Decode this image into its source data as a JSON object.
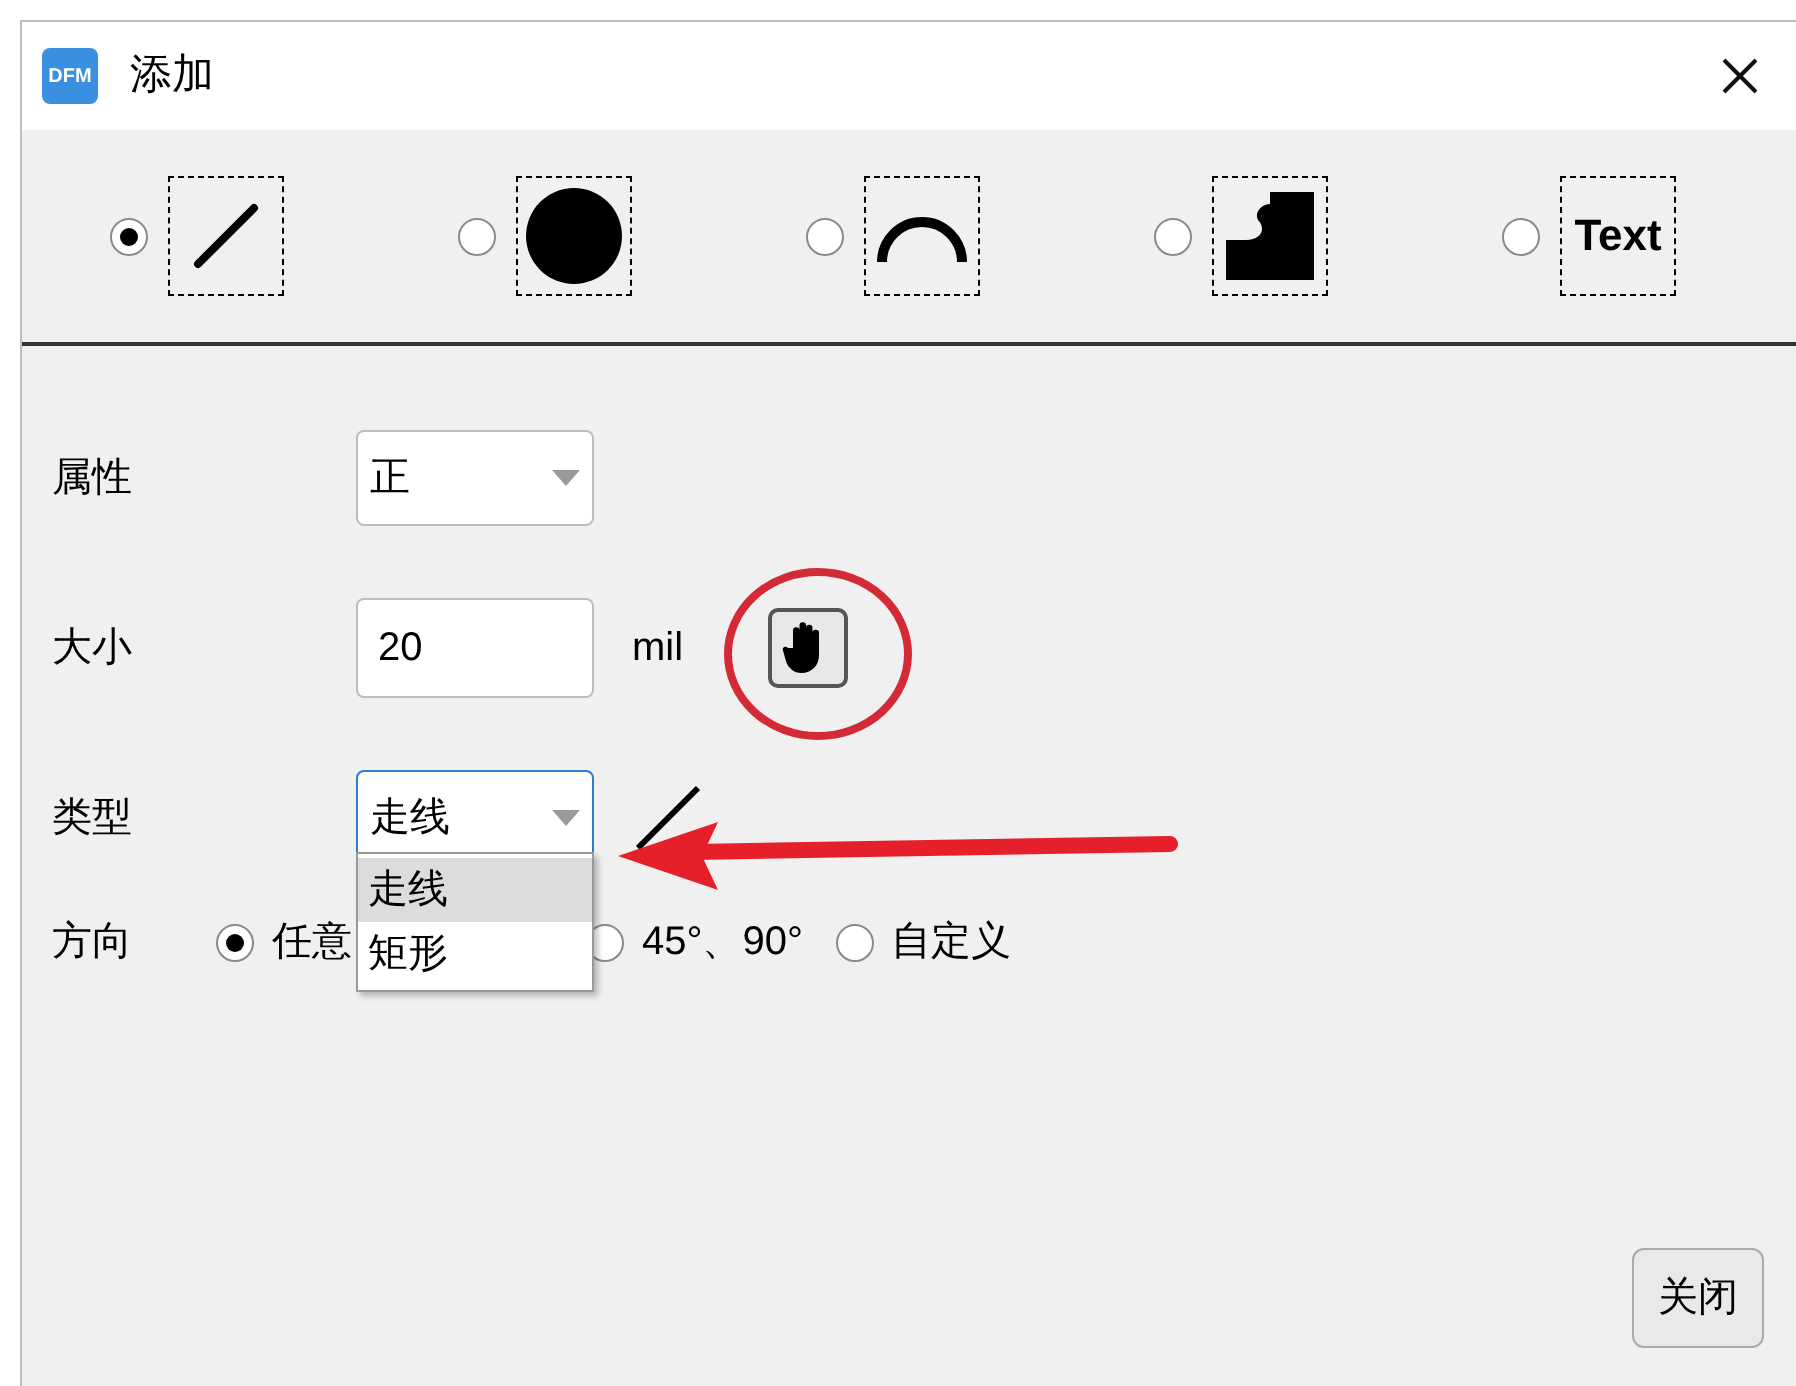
{
  "window": {
    "title": "添加",
    "app_badge": "DFM"
  },
  "shape_tools": [
    {
      "kind": "line",
      "selected": true
    },
    {
      "kind": "circle",
      "selected": false
    },
    {
      "kind": "arc",
      "selected": false
    },
    {
      "kind": "pad",
      "selected": false
    },
    {
      "kind": "text",
      "label": "Text",
      "selected": false
    }
  ],
  "attribute": {
    "label": "属性",
    "value": "正"
  },
  "size": {
    "label": "大小",
    "value": "20",
    "unit": "mil"
  },
  "type": {
    "label": "类型",
    "value": "走线",
    "focused": true,
    "options": [
      {
        "label": "走线",
        "selected": true
      },
      {
        "label": "矩形",
        "selected": false
      }
    ]
  },
  "direction": {
    "label": "方向",
    "options": [
      {
        "label": "任意",
        "selected": true
      },
      {
        "label": "45°、90°",
        "selected": false
      },
      {
        "label": "自定义",
        "selected": false
      }
    ]
  },
  "close_button": "关闭"
}
